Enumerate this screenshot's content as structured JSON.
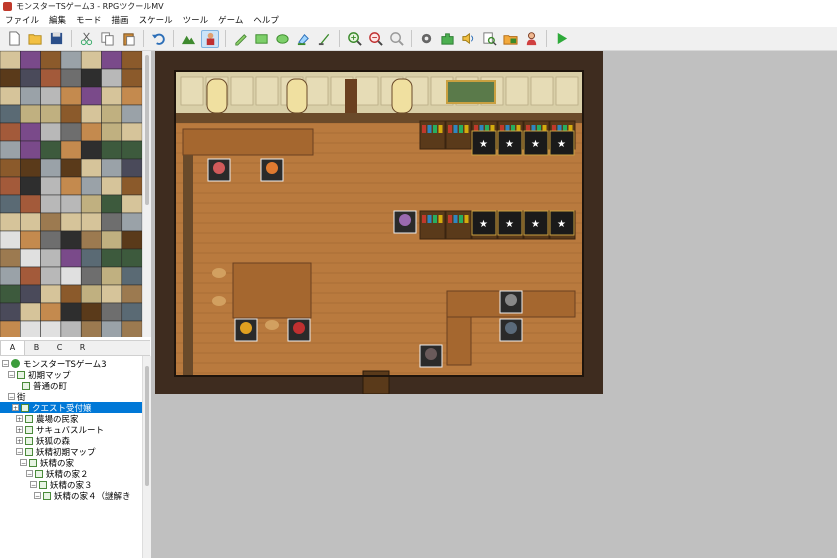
{
  "window": {
    "title": "モンスターTSゲーム3 - RPGツクールMV"
  },
  "menu": [
    "ファイル",
    "編集",
    "モード",
    "描画",
    "スケール",
    "ツール",
    "ゲーム",
    "ヘルプ"
  ],
  "toolbar": {
    "buttons": [
      "new-icon",
      "open-icon",
      "save-icon",
      "cut-icon",
      "copy-icon",
      "paste-icon",
      "undo-icon",
      "map-mode-icon",
      "event-mode-icon",
      "pencil-icon",
      "rectangle-icon",
      "ellipse-icon",
      "fill-icon",
      "shadow-pen-icon",
      "zoom-in-icon",
      "zoom-out-icon",
      "zoom-actual-icon",
      "database-icon",
      "plugin-icon",
      "sound-icon",
      "event-search-icon",
      "resource-icon",
      "character-icon",
      "playtest-icon"
    ],
    "active": "event-mode-icon"
  },
  "tileset_tabs": [
    "A",
    "B",
    "C",
    "R"
  ],
  "tileset_active_tab": "A",
  "map_tree": [
    {
      "label": "モンスターTSゲーム3",
      "level": 0,
      "type": "project"
    },
    {
      "label": "初期マップ",
      "level": 1,
      "type": "map",
      "expander": "−"
    },
    {
      "label": "普通の町",
      "level": 2,
      "type": "map"
    },
    {
      "label": "街",
      "level": 0,
      "type": "map",
      "expander": "−"
    },
    {
      "label": "クエスト受付嬢",
      "level": 1,
      "type": "map",
      "expander": "+",
      "selected": true
    },
    {
      "label": "農場の民家",
      "level": 2,
      "type": "map",
      "expander": "+"
    },
    {
      "label": "サキュバスルート",
      "level": 2,
      "type": "map",
      "expander": "+"
    },
    {
      "label": "妖狐の森",
      "level": 2,
      "type": "map",
      "expander": "+"
    },
    {
      "label": "妖精初期マップ",
      "level": 2,
      "type": "map",
      "expander": "−"
    },
    {
      "label": "妖精の家",
      "level": 2,
      "type": "map",
      "expander": "−"
    },
    {
      "label": "妖精の家２",
      "level": 3,
      "type": "map",
      "expander": "−"
    },
    {
      "label": "妖精の家３",
      "level": 4,
      "type": "map",
      "expander": "−"
    },
    {
      "label": "妖精の家４（謎解き",
      "level": 5,
      "type": "map"
    }
  ],
  "colors": {
    "selection": "#0078d7",
    "floor": "#b97a3e",
    "wall": "#d9cfa8",
    "background": "#c0c0c0"
  }
}
